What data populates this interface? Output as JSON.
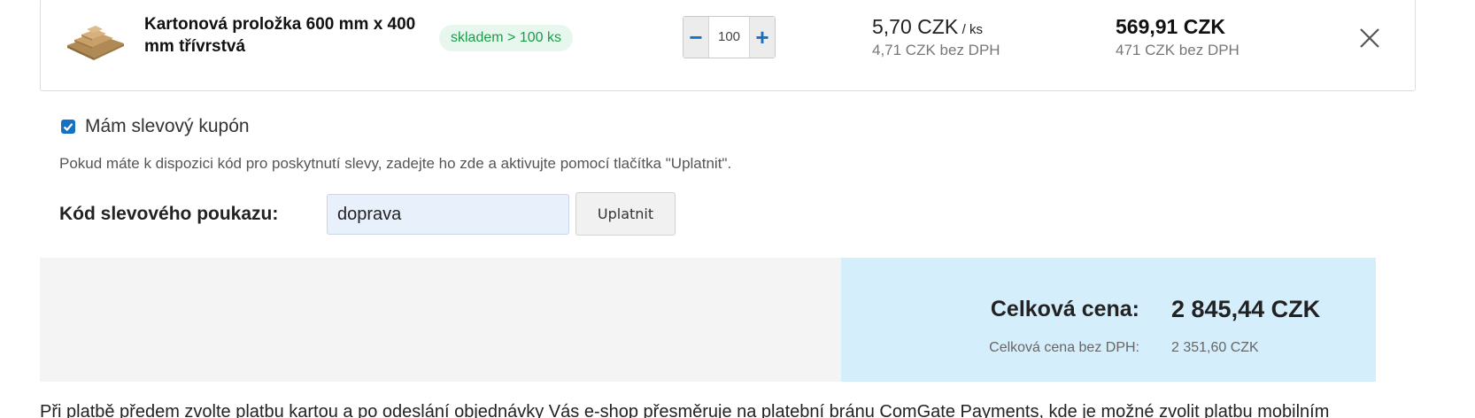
{
  "cart_item": {
    "name": "Kartonová proložka 600 mm x 400 mm třívrstvá",
    "stock": "skladem > 100 ks",
    "quantity": "100",
    "minus_icon": "minus-icon",
    "plus_icon": "plus-icon",
    "unit_price": "5,70 CZK",
    "unit_suffix": "/ ks",
    "unit_price_excl_vat": "4,71 CZK bez DPH",
    "total_price": "569,91 CZK",
    "total_price_excl_vat": "471 CZK bez DPH",
    "remove_icon": "close-icon"
  },
  "coupon": {
    "checkbox_label": "Mám slevový kupón",
    "checked": true,
    "info": "Pokud máte k dispozici kód pro poskytnutí slevy, zadejte ho zde a aktivujte pomocí tlačítka \"Uplatnit\".",
    "code_label": "Kód slevového poukazu:",
    "code_value": "doprava",
    "apply_label": "Uplatnit"
  },
  "summary": {
    "total_label": "Celková cena:",
    "total_value": "2 845,44 CZK",
    "excl_vat_label": "Celková cena bez DPH:",
    "excl_vat_value": "2 351,60 CZK"
  },
  "footer": {
    "text": "Při platbě předem zvolte platbu kartou a po odeslání objednávky Vás e-shop přesměruje na platební bránu ComGate Payments, kde je možné zvolit platbu mobilním"
  },
  "colors": {
    "accent": "#1670c4",
    "stock_green": "#1a9c4a",
    "summary_blue": "#d5eefb"
  }
}
